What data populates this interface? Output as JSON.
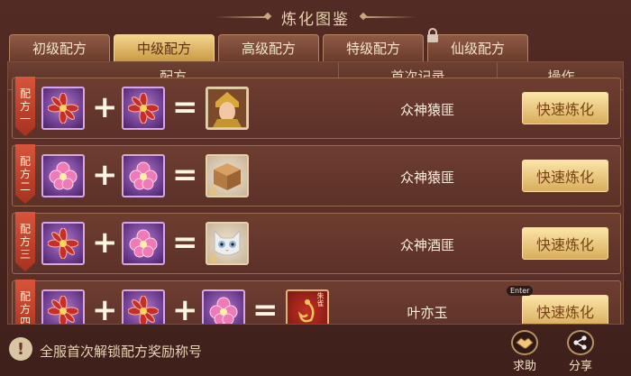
{
  "title": "炼化图鉴",
  "tabs": [
    {
      "label": "初级配方"
    },
    {
      "label": "中级配方"
    },
    {
      "label": "高级配方"
    },
    {
      "label": "特级配方"
    },
    {
      "label": "仙级配方"
    }
  ],
  "active_tab": "中级配方",
  "table": {
    "headers": {
      "recipe": "配方",
      "first_record": "首次记录",
      "action": "操作"
    },
    "rows": [
      {
        "ribbon": "配方一",
        "ribbon_chars": [
          "配",
          "方",
          "一"
        ],
        "first_record": "众神猿匪",
        "button": "快速炼化",
        "plus": "+",
        "equals": "=",
        "ingredients": [
          "flower-red-icon",
          "flower-red-icon"
        ],
        "result": "golden-warrior-portrait"
      },
      {
        "ribbon": "配方二",
        "ribbon_chars": [
          "配",
          "方",
          "二"
        ],
        "first_record": "众神猿匪",
        "button": "快速炼化",
        "plus": "+",
        "equals": "=",
        "ingredients": [
          "flower-pink-icon",
          "flower-pink-icon"
        ],
        "result": "wooden-crate-icon"
      },
      {
        "ribbon": "配方三",
        "ribbon_chars": [
          "配",
          "方",
          "三"
        ],
        "first_record": "众神酒匪",
        "button": "快速炼化",
        "plus": "+",
        "equals": "=",
        "ingredients": [
          "flower-red-icon",
          "flower-pink-icon"
        ],
        "result": "white-cat-portrait"
      },
      {
        "ribbon": "配方四",
        "ribbon_chars": [
          "配",
          "方",
          "四"
        ],
        "first_record": "叶亦玉",
        "button": "快速炼化",
        "plus": "+",
        "equals": "=",
        "ingredients": [
          "flower-red-icon",
          "flower-red-icon",
          "flower-pink-icon"
        ],
        "result": "red-scroll-item",
        "result_label": "朱雀"
      }
    ]
  },
  "footer": {
    "info_icon": "!",
    "info_text": "全服首次解锁配方奖励称号",
    "help_label": "求助",
    "share_label": "分享"
  },
  "tooltip": "Enter",
  "colors": {
    "tab_active": "#e6bd6d",
    "button": "#e9c57a",
    "ribbon": "#c4432c",
    "background": "#4a2620"
  }
}
